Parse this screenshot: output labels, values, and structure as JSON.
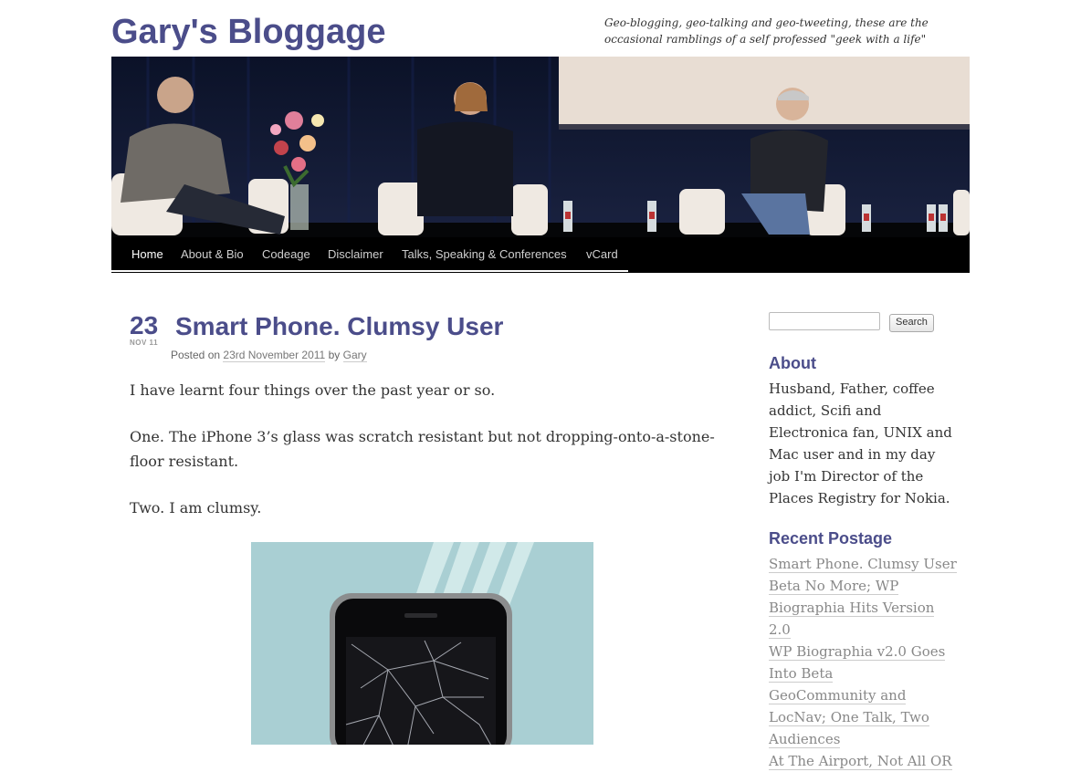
{
  "header": {
    "site_title": "Gary's Bloggage",
    "tagline": "Geo-blogging, geo-talking and geo-tweeting, these are the occasional ramblings of a self professed \"geek with a life\""
  },
  "nav": {
    "items": [
      "Home",
      "About & Bio",
      "Codeage",
      "Disclaimer",
      "Talks, Speaking & Conferences",
      "vCard"
    ],
    "active": "Home"
  },
  "post": {
    "date_day": "23",
    "date_sub": "NOV 11",
    "title": "Smart Phone. Clumsy User",
    "posted_on": "Posted on",
    "date_link": "23rd November 2011",
    "by": "by",
    "author": "Gary",
    "paragraphs": [
      "I have learnt four things over the past year or so.",
      "One. The iPhone 3’s glass was scratch resistant but not dropping-onto-a-stone-floor resistant.",
      "Two. I am clumsy."
    ]
  },
  "sidebar": {
    "search_button": "Search",
    "search_value": "",
    "about_title": "About",
    "about_text": "Husband, Father, coffee addict, Scifi and Electronica fan, UNIX and Mac user and in my day job I'm Director of the Places Registry for Nokia.",
    "recent_title": "Recent Postage",
    "recent_posts": [
      "Smart Phone. Clumsy User",
      "Beta No More; WP Biographia Hits Version 2.0",
      "WP Biographia v2.0 Goes Into Beta",
      "GeoCommunity and LocNav; One Talk, Two Audiences",
      "At The Airport, Not All OR"
    ]
  },
  "colors": {
    "title_accent": "#4b4d8a",
    "nav_background": "#000000"
  }
}
